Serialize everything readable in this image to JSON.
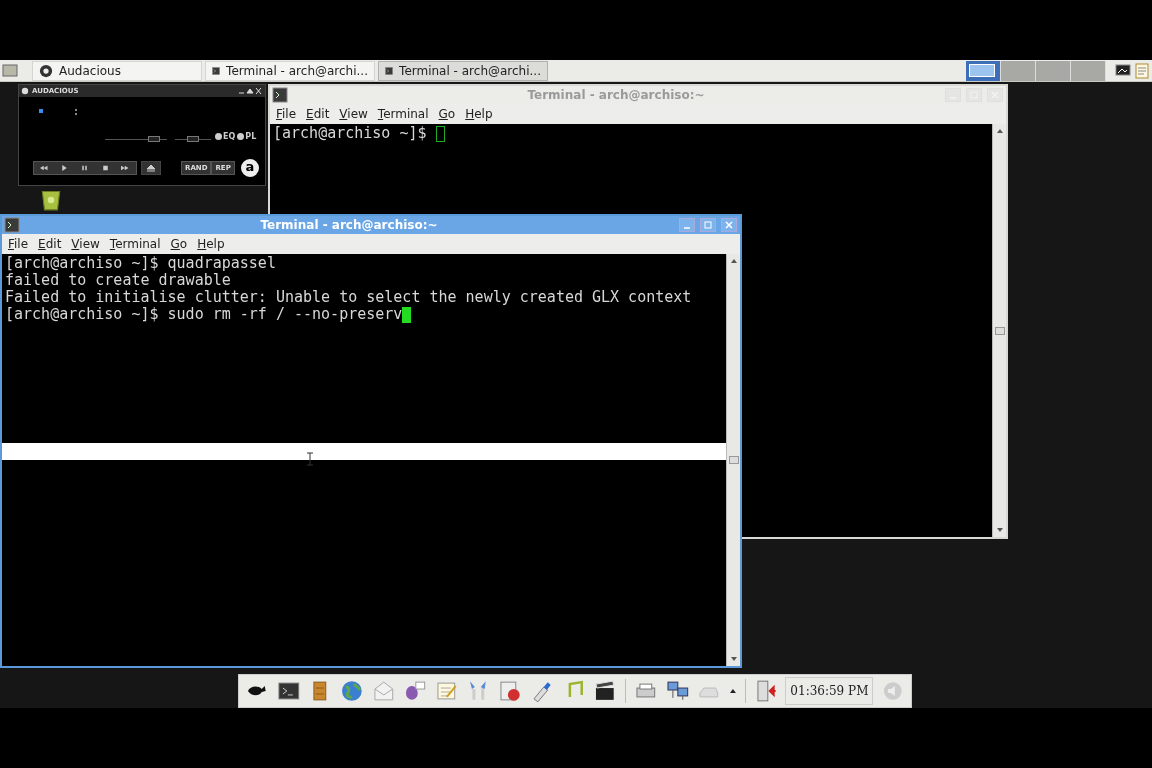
{
  "taskbar": {
    "tasks": [
      {
        "kind": "player",
        "label": "Audacious",
        "selected": false
      },
      {
        "kind": "terminal",
        "label": "Terminal - arch@archi...",
        "selected": false
      },
      {
        "kind": "terminal",
        "label": "Terminal - arch@archi...",
        "selected": true
      }
    ],
    "workspaces": [
      {
        "selected": true
      },
      {
        "selected": false
      },
      {
        "selected": false
      },
      {
        "selected": false
      }
    ]
  },
  "player": {
    "title": "AUDACIOUS",
    "volume": {
      "level": 0.85
    },
    "balance": {
      "level": 0.5
    },
    "toggles": [
      "EQ",
      "PL"
    ],
    "buttons": [
      "RAND",
      "REP"
    ],
    "logo": "a"
  },
  "windows": [
    {
      "title": "Terminal - arch@archiso:~",
      "focused": false,
      "menu": [
        "File",
        "Edit",
        "View",
        "Terminal",
        "Go",
        "Help"
      ],
      "prompt": "[arch@archiso ~]$ "
    },
    {
      "title": "Terminal - arch@archiso:~",
      "focused": true,
      "menu": [
        "File",
        "Edit",
        "View",
        "Terminal",
        "Go",
        "Help"
      ],
      "lines": [
        "[arch@archiso ~]$ quadrapassel",
        "failed to create drawable",
        "Failed to initialise clutter: Unable to select the newly created GLX context"
      ],
      "prompt": "[arch@archiso ~]$ sudo rm -rf / --no-preserv"
    }
  ],
  "panel": {
    "clock": "01:36:59 PM"
  }
}
